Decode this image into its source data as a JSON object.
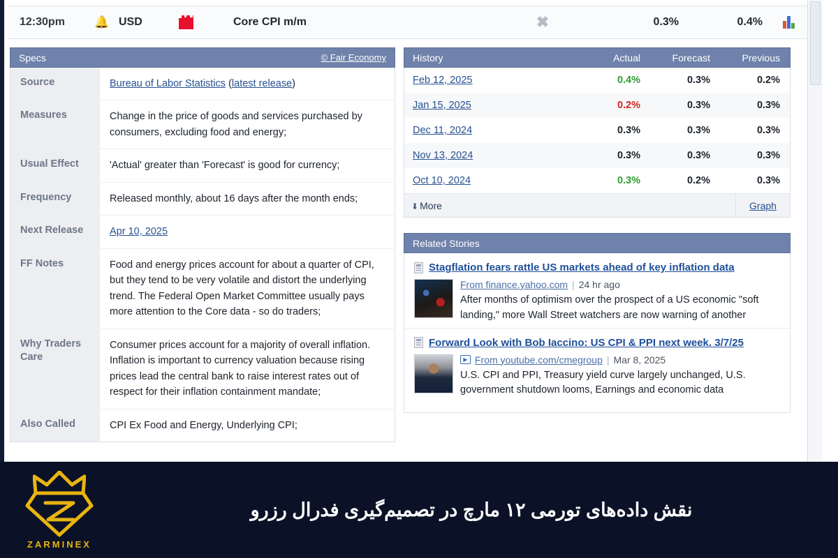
{
  "event": {
    "time": "12:30pm",
    "alarm_icon": "alarm-bell-icon",
    "currency": "USD",
    "impact_icon": "red-folder-impact-icon",
    "title": "Core CPI m/m",
    "graph_toggle_icon": "graph-x-icon",
    "actual": "0.3%",
    "forecast": "0.4%",
    "chart_icon": "bar-chart-icon"
  },
  "specs": {
    "header": "Specs",
    "credit": "© Fair Economy",
    "rows": [
      {
        "key": "Source",
        "link": "Bureau of Labor Statistics",
        "paren_open": " (",
        "link2": "latest release",
        "paren_close": ")"
      },
      {
        "key": "Measures",
        "value": "Change in the price of goods and services purchased by consumers, excluding food and energy;"
      },
      {
        "key": "Usual Effect",
        "value": "'Actual' greater than 'Forecast' is good for currency;"
      },
      {
        "key": "Frequency",
        "value": "Released monthly, about 16 days after the month ends;"
      },
      {
        "key": "Next Release",
        "link": "Apr 10, 2025"
      },
      {
        "key": "FF Notes",
        "value": "Food and energy prices account for about a quarter of CPI, but they tend to be very volatile and distort the underlying trend. The Federal Open Market Committee usually pays more attention to the Core data - so do traders;"
      },
      {
        "key": "Why Traders Care",
        "value": "Consumer prices account for a majority of overall inflation. Inflation is important to currency valuation because rising prices lead the central bank to raise interest rates out of respect for their inflation containment mandate;"
      },
      {
        "key": "Also Called",
        "value": "CPI Ex Food and Energy, Underlying CPI;"
      }
    ]
  },
  "history": {
    "header": "History",
    "columns": [
      "Actual",
      "Forecast",
      "Previous"
    ],
    "rows": [
      {
        "date": "Feb 12, 2025",
        "actual": "0.4%",
        "actual_state": "up",
        "forecast": "0.3%",
        "previous": "0.2%"
      },
      {
        "date": "Jan 15, 2025",
        "actual": "0.2%",
        "actual_state": "down",
        "forecast": "0.3%",
        "previous": "0.3%"
      },
      {
        "date": "Dec 11, 2024",
        "actual": "0.3%",
        "actual_state": "neutral",
        "forecast": "0.3%",
        "previous": "0.3%"
      },
      {
        "date": "Nov 13, 2024",
        "actual": "0.3%",
        "actual_state": "neutral",
        "forecast": "0.3%",
        "previous": "0.3%"
      },
      {
        "date": "Oct 10, 2024",
        "actual": "0.3%",
        "actual_state": "up",
        "forecast": "0.2%",
        "previous": "0.3%"
      }
    ],
    "more_label": "More",
    "more_icon": "download-arrow-icon",
    "graph_label": "Graph"
  },
  "related_stories": {
    "header": "Related Stories",
    "items": [
      {
        "icon": "news-article-icon",
        "title": "Stagflation fears rattle US markets ahead of key inflation data",
        "source": "From finance.yahoo.com",
        "separator": "|",
        "time": "24 hr ago",
        "excerpt": "After months of optimism over the prospect of a US economic \"soft landing,\" more Wall Street watchers are now warning of another",
        "has_play_icon": false,
        "thumb": "t1"
      },
      {
        "icon": "news-article-icon",
        "title": "Forward Look with Bob Iaccino: US CPI & PPI next week. 3/7/25",
        "source": "From youtube.com/cmegroup",
        "separator": "|",
        "time": "Mar 8, 2025",
        "excerpt": "U.S. CPI and PPI, Treasury yield curve largely unchanged, U.S. government shutdown looms, Earnings and economic data",
        "has_play_icon": true,
        "play_icon": "play-video-icon",
        "thumb": "t2"
      }
    ]
  },
  "banner": {
    "logo_icon": "zarminex-crown-diamond-logo",
    "logo_text": "ZARMINEX",
    "headline": "نقش داده‌های تورمی ۱۲ مارچ در تصمیم‌گیری فدرال رزرو"
  },
  "colors": {
    "panel_header": "#6f82ab",
    "link": "#27518f",
    "up": "#2f9e2f",
    "down": "#d0271d",
    "impact_red": "#e8112d",
    "banner_bg": "#0b1227",
    "logo_gold": "#e8b410"
  }
}
